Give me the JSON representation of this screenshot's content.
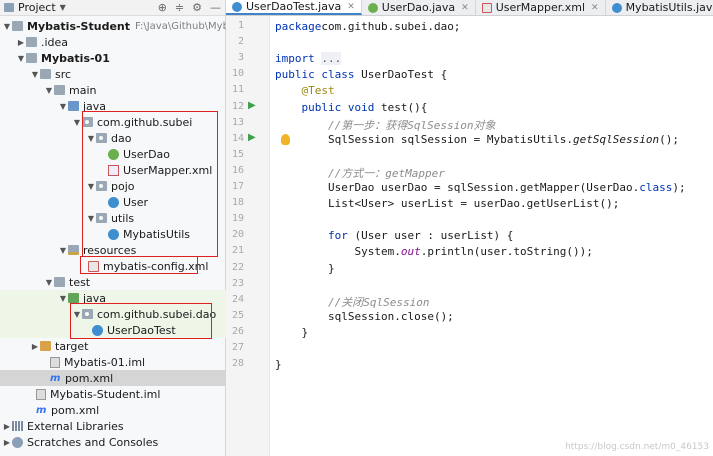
{
  "project_panel": {
    "title": "Project",
    "tree": [
      {
        "label": "Mybatis-Student",
        "path": "F:\\Java\\Github\\Mybatis",
        "bold": true
      },
      {
        "label": ".idea"
      },
      {
        "label": "Mybatis-01",
        "bold": true
      },
      {
        "label": "src"
      },
      {
        "label": "main"
      },
      {
        "label": "java"
      },
      {
        "label": "com.github.subei"
      },
      {
        "label": "dao"
      },
      {
        "label": "UserDao"
      },
      {
        "label": "UserMapper.xml"
      },
      {
        "label": "pojo"
      },
      {
        "label": "User"
      },
      {
        "label": "utils"
      },
      {
        "label": "MybatisUtils"
      },
      {
        "label": "resources"
      },
      {
        "label": "mybatis-config.xml"
      },
      {
        "label": "test"
      },
      {
        "label": "java"
      },
      {
        "label": "com.github.subei.dao"
      },
      {
        "label": "UserDaoTest"
      },
      {
        "label": "target"
      },
      {
        "label": "Mybatis-01.iml"
      },
      {
        "label": "pom.xml"
      },
      {
        "label": "Mybatis-Student.iml"
      },
      {
        "label": "pom.xml"
      },
      {
        "label": "External Libraries"
      },
      {
        "label": "Scratches and Consoles"
      }
    ]
  },
  "tabs": [
    {
      "label": "UserDaoTest.java",
      "icon": "class-c-icon",
      "active": true
    },
    {
      "label": "UserDao.java",
      "icon": "interface-i-icon",
      "active": false
    },
    {
      "label": "UserMapper.xml",
      "icon": "xml-file-icon",
      "active": false
    },
    {
      "label": "MybatisUtils.java",
      "icon": "class-c-icon",
      "active": false
    }
  ],
  "editor": {
    "line_numbers": [
      "1",
      "2",
      "3",
      "10",
      "11",
      "12",
      "13",
      "14",
      "15",
      "16",
      "17",
      "18",
      "19",
      "20",
      "21",
      "22",
      "23",
      "24",
      "25",
      "26",
      "27",
      "28"
    ],
    "lines": [
      {
        "parts": [
          [
            "kw",
            "package"
          ],
          [
            "",
            "com.github.subei.dao;"
          ]
        ]
      },
      {
        "parts": []
      },
      {
        "parts": [
          [
            "kw",
            "import "
          ],
          [
            "folded",
            "..."
          ]
        ]
      },
      {
        "parts": [
          [
            "kw",
            "public class "
          ],
          [
            "",
            "UserDaoTest {"
          ]
        ]
      },
      {
        "parts": [
          [
            "",
            "    "
          ],
          [
            "ann",
            "@Test"
          ]
        ]
      },
      {
        "parts": [
          [
            "",
            "    "
          ],
          [
            "kw",
            "public void "
          ],
          [
            "",
            "test(){"
          ]
        ]
      },
      {
        "parts": [
          [
            "",
            "        "
          ],
          [
            "cmt",
            "//第一步：获得SqlSession对象"
          ]
        ]
      },
      {
        "parts": [
          [
            "",
            "        SqlSession sqlSession = MybatisUtils."
          ],
          [
            "st",
            "getSqlSession"
          ],
          [
            "",
            "();"
          ]
        ]
      },
      {
        "parts": []
      },
      {
        "parts": [
          [
            "",
            "        "
          ],
          [
            "cmt",
            "//方式一：getMapper"
          ]
        ]
      },
      {
        "parts": [
          [
            "",
            "        UserDao userDao = sqlSession.getMapper(UserDao."
          ],
          [
            "kw",
            "class"
          ],
          [
            "",
            ");"
          ]
        ]
      },
      {
        "parts": [
          [
            "",
            "        List<User> userList = userDao.getUserList();"
          ]
        ]
      },
      {
        "parts": []
      },
      {
        "parts": [
          [
            "",
            "        "
          ],
          [
            "kw",
            "for "
          ],
          [
            "",
            "(User user : userList) {"
          ]
        ]
      },
      {
        "parts": [
          [
            "",
            "            System."
          ],
          [
            "fld",
            "out"
          ],
          [
            "",
            ".println(user.toString());"
          ]
        ]
      },
      {
        "parts": [
          [
            "",
            "        }"
          ]
        ]
      },
      {
        "parts": []
      },
      {
        "parts": [
          [
            "",
            "        "
          ],
          [
            "cmt",
            "//关闭SqlSession"
          ]
        ]
      },
      {
        "parts": [
          [
            "",
            "        sqlSession.close();"
          ]
        ]
      },
      {
        "parts": [
          [
            "",
            "    }"
          ]
        ]
      },
      {
        "parts": []
      },
      {
        "parts": [
          [
            "",
            "}"
          ]
        ]
      }
    ]
  },
  "watermark": "https://blog.csdn.net/m0_46153"
}
